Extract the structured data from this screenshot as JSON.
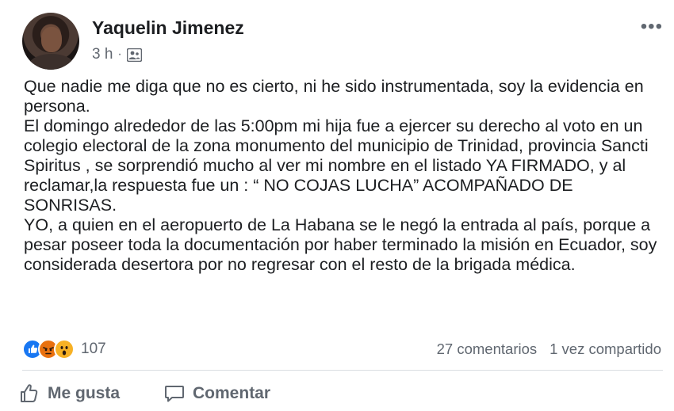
{
  "post": {
    "author": "Yaquelin Jimenez",
    "time": "3 h",
    "separator": "·",
    "audience_icon": "friends-audience-icon",
    "more_label": "•••",
    "paragraphs": [
      "Que nadie me diga que no es cierto, ni he sido instrumentada, soy la evidencia en persona.",
      "El domingo alrededor de las 5:00pm mi hija fue a ejercer su derecho al voto en un colegio electoral de la zona monumento del municipio de Trinidad, provincia Sancti Spiritus , se sorprendió mucho al ver mi nombre en el listado YA FIRMADO, y al reclamar,la respuesta fue un : “ NO COJAS LUCHA” ACOMPAÑADO DE SONRISAS.",
      "YO,  a quien en el aeropuerto de La Habana se le negó la entrada al país, porque a pesar poseer toda la documentación por haber terminado  la misión en Ecuador, soy  considerada desertora por no regresar con el resto de la brigada médica."
    ]
  },
  "reactions": {
    "icons": [
      "like-reaction-icon",
      "angry-reaction-icon",
      "wow-reaction-icon"
    ],
    "count": "107",
    "comments": "27 comentarios",
    "shares": "1 vez compartido"
  },
  "actions": {
    "like_label": "Me gusta",
    "comment_label": "Comentar"
  },
  "colors": {
    "like": "#1877f2",
    "angry": "#e9710f",
    "wow": "#f7b125",
    "secondary_text": "#606770"
  }
}
